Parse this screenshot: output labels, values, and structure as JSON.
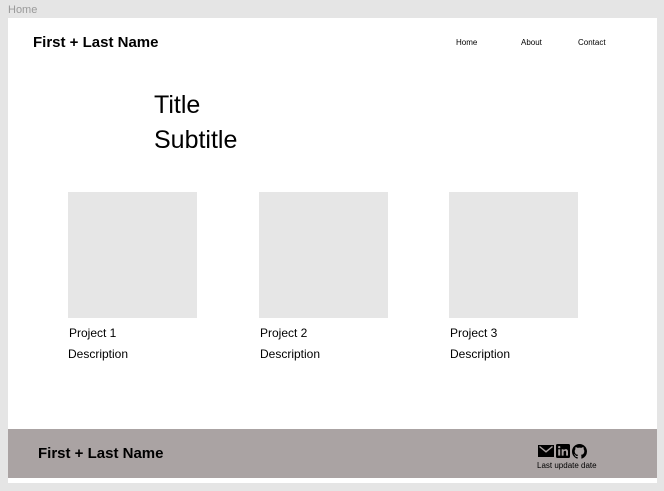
{
  "frame": {
    "label": "Home"
  },
  "header": {
    "brand": "First + Last Name",
    "nav": [
      {
        "label": "Home"
      },
      {
        "label": "About"
      },
      {
        "label": "Contact"
      }
    ]
  },
  "hero": {
    "title": "Title",
    "subtitle": "Subtitle"
  },
  "projects": [
    {
      "name": "Project 1",
      "description": "Description"
    },
    {
      "name": "Project 2",
      "description": "Description"
    },
    {
      "name": "Project 3",
      "description": "Description"
    }
  ],
  "footer": {
    "brand": "First + Last Name",
    "icons": [
      "mail-icon",
      "linkedin-icon",
      "github-icon"
    ],
    "update_label": "Last update date"
  },
  "colors": {
    "canvas": "#e5e5e5",
    "page": "#ffffff",
    "thumbnail": "#e6e6e6",
    "footer": "#aaa3a3"
  }
}
